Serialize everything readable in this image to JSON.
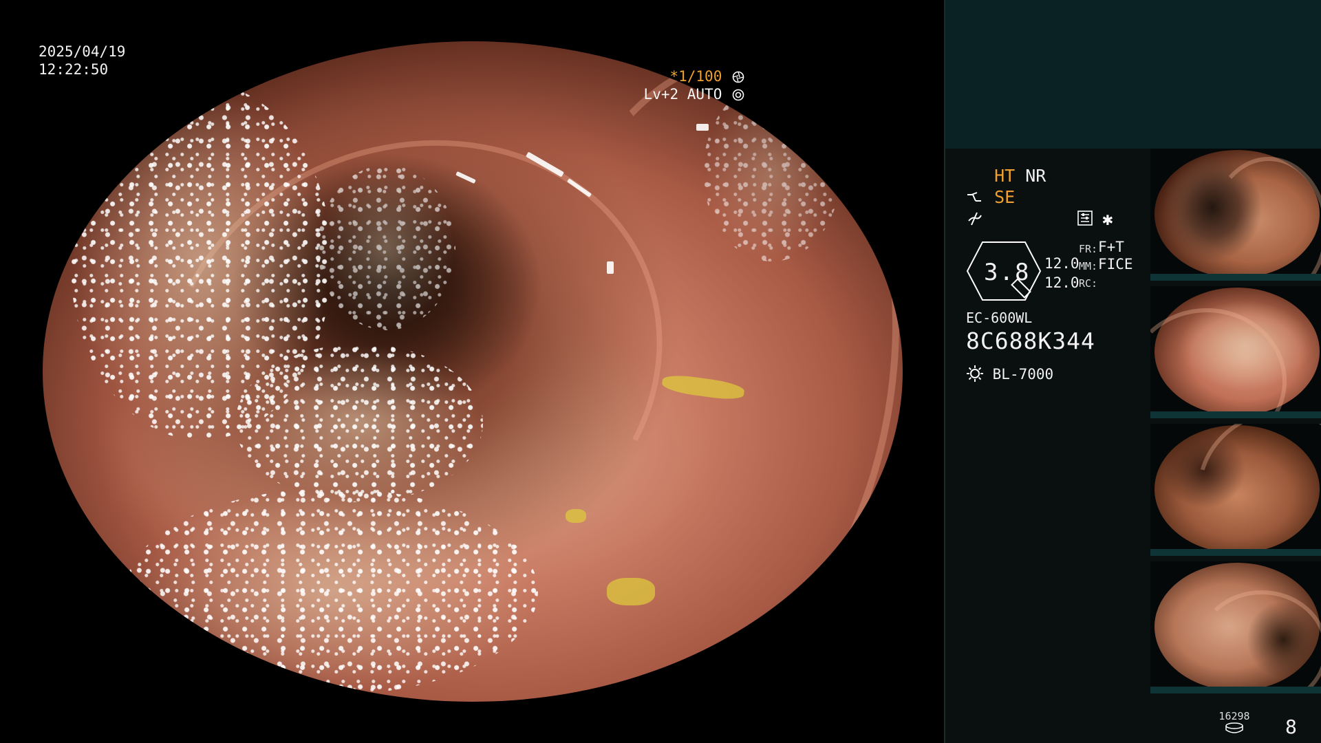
{
  "overlay": {
    "date": "2025/04/19",
    "time": "12:22:50",
    "shutter": "*1/100",
    "exposure": "Lv+2 AUTO"
  },
  "panel": {
    "modes": {
      "ht": "HT",
      "nr": "NR",
      "se": "SE"
    },
    "scale": "3.8",
    "gain_top": "12.0",
    "gain_bottom": "12.0",
    "labels": {
      "fr_label": "FR:",
      "fr_value": "F+T",
      "mm_label": "MM:",
      "mm_value": "FICE",
      "rc_label": "RC:",
      "rc_value": ""
    },
    "scope_model": "EC-600WL",
    "scope_serial": "8C688K344",
    "light_source": "BL-7000",
    "storage_count": "16298",
    "page_number": "8"
  },
  "colors": {
    "accent_orange": "#f0a030",
    "panel_header": "#0b2224",
    "panel_bg": "#0a0f0f",
    "thumb_strip": "#0f3436"
  },
  "icons": {
    "shutter": "aperture-icon",
    "exposure": "gear-icon",
    "structure": "filter-curve-icon",
    "freeze": "signal-icon",
    "menu": "grid-icon",
    "star": "asterisk-icon",
    "light": "sun-icon",
    "storage": "disk-icon"
  }
}
